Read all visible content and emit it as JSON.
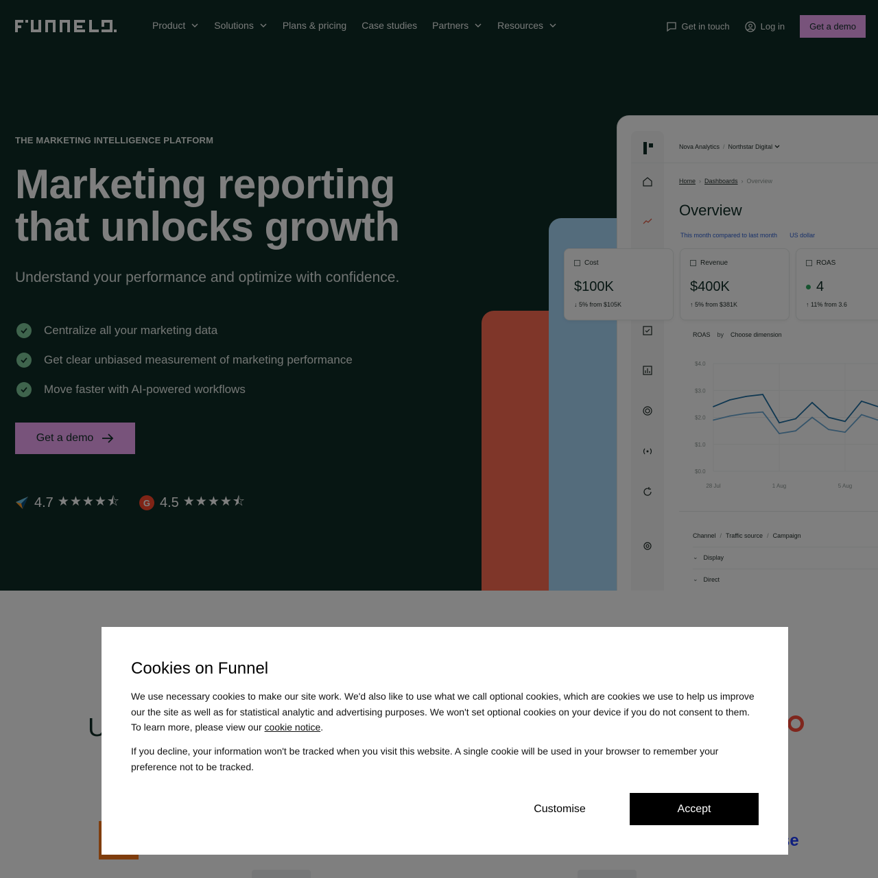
{
  "nav": {
    "brand": "Funnel",
    "menu": [
      {
        "label": "Product",
        "has_dropdown": true
      },
      {
        "label": "Solutions",
        "has_dropdown": true
      },
      {
        "label": "Plans & pricing",
        "has_dropdown": false
      },
      {
        "label": "Case studies",
        "has_dropdown": false
      },
      {
        "label": "Partners",
        "has_dropdown": true
      },
      {
        "label": "Resources",
        "has_dropdown": true
      }
    ],
    "get_in_touch": "Get in touch",
    "log_in": "Log in",
    "get_demo": "Get a demo"
  },
  "hero": {
    "eyebrow": "THE MARKETING INTELLIGENCE PLATFORM",
    "headline_line1": "Marketing reporting",
    "headline_line2": "that unlocks growth",
    "subline": "Understand your performance and optimize with confidence.",
    "bullets": [
      "Centralize all your marketing data",
      "Get clear unbiased measurement of marketing performance",
      "Move faster with AI-powered workflows"
    ],
    "cta": "Get a demo",
    "ratings": [
      {
        "source_icon": "capterra-icon",
        "score": "4.7",
        "stars": "★★★★⯪"
      },
      {
        "source_icon": "g2-icon",
        "badge": "G",
        "score": "4.5",
        "stars": "★★★★⯪"
      }
    ]
  },
  "dashboard": {
    "org": "Nova Analytics",
    "sub_org": "Northstar Digital",
    "breadcrumbs": [
      "Home",
      "Dashboards",
      "Overview"
    ],
    "title": "Overview",
    "filter_period": "This month compared to last month",
    "filter_currency": "US dollar",
    "kpis": [
      {
        "label": "Cost",
        "value": "$100K",
        "delta": "↓ 5% from $105K"
      },
      {
        "label": "Revenue",
        "value": "$400K",
        "delta": "↑ 5% from $381K"
      },
      {
        "label": "ROAS",
        "value": "4",
        "delta": "↑ 11% from 3.6"
      }
    ],
    "chart_controls": {
      "metric": "ROAS",
      "by": "by",
      "dimension": "Choose dimension"
    },
    "table": {
      "levels": [
        "Channel",
        "Traffic source",
        "Campaign"
      ],
      "rows": [
        "Display",
        "Direct"
      ]
    }
  },
  "chart_data": {
    "type": "line",
    "title": "",
    "xlabel": "",
    "ylabel": "",
    "y_ticks": [
      "$4.0",
      "$3.0",
      "$2.0",
      "$1.0",
      "$0.0"
    ],
    "x_ticks": [
      "28 Jul",
      "1 Aug",
      "5 Aug"
    ],
    "ylim": [
      0,
      4
    ],
    "x": [
      "28 Jul",
      "29 Jul",
      "30 Jul",
      "31 Jul",
      "1 Aug",
      "2 Aug",
      "3 Aug",
      "4 Aug",
      "5 Aug",
      "6 Aug",
      "7 Aug"
    ],
    "series": [
      {
        "values": [
          2.4,
          2.65,
          2.78,
          2.85,
          1.8,
          1.95,
          2.55,
          2.0,
          1.85,
          2.6,
          2.4
        ],
        "color": "#1f6fa3"
      },
      {
        "values": [
          1.9,
          2.05,
          2.15,
          2.2,
          1.4,
          1.5,
          2.0,
          1.55,
          1.45,
          2.1,
          1.9
        ],
        "color": "#6aa8d4"
      }
    ],
    "grid": true
  },
  "cookie": {
    "title": "Cookies on Funnel",
    "p1_before": "We use necessary cookies to make our site work. We'd also like to use what we call optional cookies, which are cookies we use to help us improve our the site as well as for statistical analytic and advertising purposes. We won't set optional cookies on your device if you do not consent to them. To learn more, please view our ",
    "p1_link": "cookie notice",
    "p1_after": ".",
    "p2": "If you decline, your information won't be tracked when you visit this website. A single cookie will be used in your browser to remember your preference not to be tracked.",
    "customise": "Customise",
    "accept": "Accept"
  },
  "lower": {
    "partial_heading": "U",
    "partial_logo_text": "se"
  },
  "colors": {
    "hero_bg": "#0f2d26",
    "accent_pink": "#f0a6f6",
    "check_green": "#7ec89b",
    "deco_red": "#ff6c52",
    "deco_blue": "#a9d8f9"
  }
}
